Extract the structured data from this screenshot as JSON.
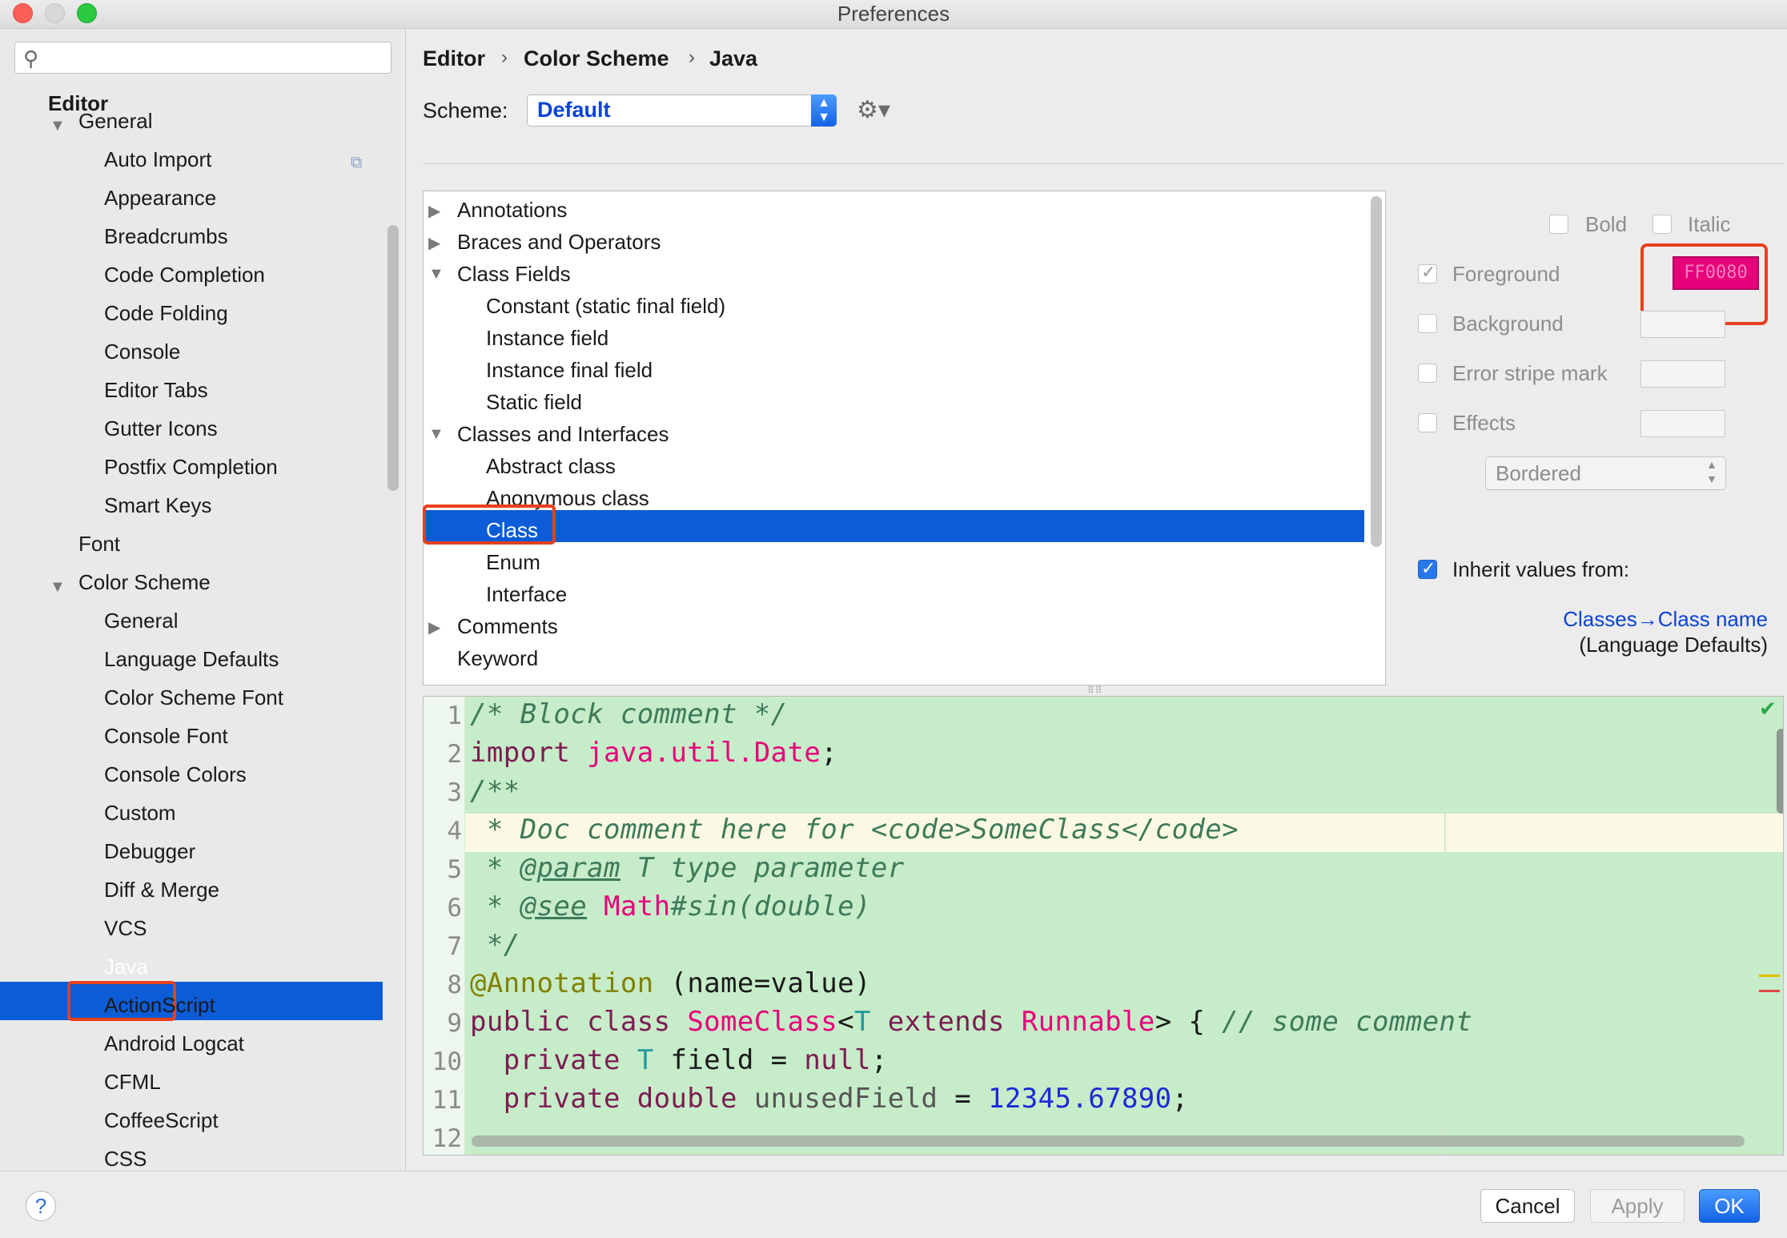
{
  "window": {
    "title": "Preferences"
  },
  "search": {
    "placeholder": ""
  },
  "sidebar": {
    "section": "Editor",
    "items": [
      {
        "label": "General",
        "level": 1,
        "expanded": true
      },
      {
        "label": "Auto Import",
        "level": 2
      },
      {
        "label": "Appearance",
        "level": 2
      },
      {
        "label": "Breadcrumbs",
        "level": 2
      },
      {
        "label": "Code Completion",
        "level": 2
      },
      {
        "label": "Code Folding",
        "level": 2
      },
      {
        "label": "Console",
        "level": 2
      },
      {
        "label": "Editor Tabs",
        "level": 2
      },
      {
        "label": "Gutter Icons",
        "level": 2
      },
      {
        "label": "Postfix Completion",
        "level": 2
      },
      {
        "label": "Smart Keys",
        "level": 2
      },
      {
        "label": "Font",
        "level": 1
      },
      {
        "label": "Color Scheme",
        "level": 1,
        "expanded": true
      },
      {
        "label": "General",
        "level": 2
      },
      {
        "label": "Language Defaults",
        "level": 2
      },
      {
        "label": "Color Scheme Font",
        "level": 2
      },
      {
        "label": "Console Font",
        "level": 2
      },
      {
        "label": "Console Colors",
        "level": 2
      },
      {
        "label": "Custom",
        "level": 2
      },
      {
        "label": "Debugger",
        "level": 2
      },
      {
        "label": "Diff & Merge",
        "level": 2
      },
      {
        "label": "VCS",
        "level": 2
      },
      {
        "label": "Java",
        "level": 2,
        "selected": true
      },
      {
        "label": "ActionScript",
        "level": 2
      },
      {
        "label": "Android Logcat",
        "level": 2
      },
      {
        "label": "CFML",
        "level": 2
      },
      {
        "label": "CoffeeScript",
        "level": 2
      },
      {
        "label": "CSS",
        "level": 2
      }
    ]
  },
  "breadcrumb": [
    "Editor",
    "Color Scheme",
    "Java"
  ],
  "scheme": {
    "label": "Scheme:",
    "value": "Default"
  },
  "attributes": [
    {
      "label": "Annotations",
      "indent": 0,
      "arrow": "collapsed"
    },
    {
      "label": "Braces and Operators",
      "indent": 0,
      "arrow": "collapsed"
    },
    {
      "label": "Class Fields",
      "indent": 0,
      "arrow": "expanded"
    },
    {
      "label": "Constant (static final field)",
      "indent": 1
    },
    {
      "label": "Instance field",
      "indent": 1
    },
    {
      "label": "Instance final field",
      "indent": 1
    },
    {
      "label": "Static field",
      "indent": 1
    },
    {
      "label": "Classes and Interfaces",
      "indent": 0,
      "arrow": "expanded"
    },
    {
      "label": "Abstract class",
      "indent": 1
    },
    {
      "label": "Anonymous class",
      "indent": 1
    },
    {
      "label": "Class",
      "indent": 1,
      "selected": true
    },
    {
      "label": "Enum",
      "indent": 1
    },
    {
      "label": "Interface",
      "indent": 1
    },
    {
      "label": "Comments",
      "indent": 0,
      "arrow": "collapsed"
    },
    {
      "label": "Keyword",
      "indent": 0
    }
  ],
  "options": {
    "bold": "Bold",
    "italic": "Italic",
    "foreground": "Foreground",
    "foreground_value": "FF0080",
    "foreground_color": "#E6007A",
    "background": "Background",
    "error_stripe": "Error stripe mark",
    "effects": "Effects",
    "effects_type": "Bordered",
    "inherit": "Inherit values from:",
    "inherit_link": "Classes→Class name",
    "inherit_source": "(Language Defaults)"
  },
  "preview": {
    "line_numbers": [
      "1",
      "2",
      "3",
      "4",
      "5",
      "6",
      "7",
      "8",
      "9",
      "10",
      "11",
      "12"
    ],
    "lines": [
      [
        {
          "t": "/* Block comment */",
          "c": "c-com"
        }
      ],
      [
        {
          "t": "import ",
          "c": "c-kw"
        },
        {
          "t": "java.util.Date",
          "c": "c-pink"
        },
        {
          "t": ";",
          "c": ""
        }
      ],
      [
        {
          "t": "/**",
          "c": "c-com"
        }
      ],
      [
        {
          "t": " * Doc comment here for <code>SomeClass</code>",
          "c": "c-com"
        }
      ],
      [
        {
          "t": " * ",
          "c": "c-com"
        },
        {
          "t": "@param",
          "c": "c-com c-doc"
        },
        {
          "t": " T type parameter",
          "c": "c-com"
        }
      ],
      [
        {
          "t": " * ",
          "c": "c-com"
        },
        {
          "t": "@see",
          "c": "c-com c-doc"
        },
        {
          "t": " ",
          "c": "c-com"
        },
        {
          "t": "Math",
          "c": "c-pink"
        },
        {
          "t": "#sin(double)",
          "c": "c-com"
        }
      ],
      [
        {
          "t": " */",
          "c": "c-com"
        }
      ],
      [
        {
          "t": "@Annotation",
          "c": "c-ann"
        },
        {
          "t": " (name=value)",
          "c": ""
        }
      ],
      [
        {
          "t": "public class ",
          "c": "c-kw"
        },
        {
          "t": "SomeClass",
          "c": "c-pink"
        },
        {
          "t": "<",
          "c": ""
        },
        {
          "t": "T",
          "c": "c-type"
        },
        {
          "t": " extends ",
          "c": "c-kw"
        },
        {
          "t": "Runnable",
          "c": "c-pink"
        },
        {
          "t": "> { ",
          "c": ""
        },
        {
          "t": "// some comment",
          "c": "c-com"
        }
      ],
      [
        {
          "t": "  private ",
          "c": "c-kw"
        },
        {
          "t": "T",
          "c": "c-type"
        },
        {
          "t": " field = ",
          "c": ""
        },
        {
          "t": "null",
          "c": "c-kw"
        },
        {
          "t": ";",
          "c": ""
        }
      ],
      [
        {
          "t": "  private double ",
          "c": "c-kw"
        },
        {
          "t": "unusedField",
          "c": "c-gray"
        },
        {
          "t": " = ",
          "c": ""
        },
        {
          "t": "12345.67890",
          "c": "c-num"
        },
        {
          "t": ";",
          "c": ""
        }
      ]
    ]
  },
  "buttons": {
    "help": "?",
    "cancel": "Cancel",
    "apply": "Apply",
    "ok": "OK"
  },
  "colors": {
    "selection": "#0B5CD6",
    "highlight_box": "#E8401C",
    "preview_bg": "#C7ECC9"
  }
}
